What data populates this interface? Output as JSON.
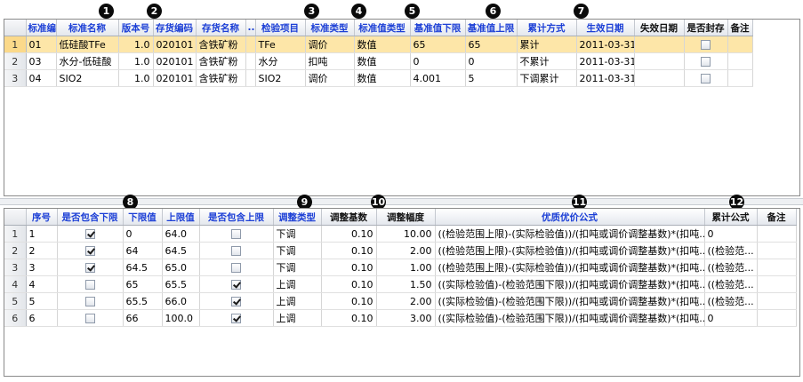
{
  "top_table": {
    "columns": [
      "",
      "标准编码",
      "标准名称",
      "版本号",
      "存货编码",
      "存货名称",
      "...",
      "检验项目",
      "标准类型",
      "标准值类型",
      "基准值下限",
      "基准值上限",
      "累计方式",
      "生效日期",
      "失效日期",
      "是否封存",
      "备注"
    ],
    "rows": [
      {
        "n": "1",
        "code": "01",
        "name": "低硅酸TFe",
        "version": "1.0",
        "inv_code": "020101",
        "inv_name": "含铁矿粉",
        "more": "",
        "item": "TFe",
        "std_type": "调价",
        "value_type": "数值",
        "lower": "65",
        "upper": "65",
        "accum": "累计",
        "effective": "2011-03-31",
        "expire": "",
        "sealed": false,
        "note": ""
      },
      {
        "n": "2",
        "code": "03",
        "name": "水分-低硅酸",
        "version": "1.0",
        "inv_code": "020101",
        "inv_name": "含铁矿粉",
        "more": "",
        "item": "水分",
        "std_type": "扣吨",
        "value_type": "数值",
        "lower": "0",
        "upper": "0",
        "accum": "不累计",
        "effective": "2011-03-31",
        "expire": "",
        "sealed": false,
        "note": ""
      },
      {
        "n": "3",
        "code": "04",
        "name": "SIO2",
        "version": "1.0",
        "inv_code": "020101",
        "inv_name": "含铁矿粉",
        "more": "",
        "item": "SIO2",
        "std_type": "调价",
        "value_type": "数值",
        "lower": "4.001",
        "upper": "5",
        "accum": "下调累计",
        "effective": "2011-03-31",
        "expire": "",
        "sealed": false,
        "note": ""
      }
    ]
  },
  "bottom_table": {
    "columns": [
      "",
      "序号",
      "是否包含下限",
      "下限值",
      "上限值",
      "是否包含上限",
      "调整类型",
      "调整基数",
      "调整幅度",
      "优质优价公式",
      "累计公式",
      "备注"
    ],
    "rows": [
      {
        "n": "1",
        "seq": "1",
        "incl_lower": true,
        "lower": "0",
        "upper": "64.0",
        "incl_upper": false,
        "adj_type": "下调",
        "base": "0.10",
        "range": "10.00",
        "formula": "((检验范围上限)-(实际检验值))/(扣吨或调价调整基数)*(扣吨...",
        "accum": "0",
        "note": ""
      },
      {
        "n": "2",
        "seq": "2",
        "incl_lower": true,
        "lower": "64",
        "upper": "64.5",
        "incl_upper": false,
        "adj_type": "下调",
        "base": "0.10",
        "range": "2.00",
        "formula": "((检验范围上限)-(实际检验值))/(扣吨或调价调整基数)*(扣吨...",
        "accum": "((检验范...",
        "note": ""
      },
      {
        "n": "3",
        "seq": "3",
        "incl_lower": true,
        "lower": "64.5",
        "upper": "65.0",
        "incl_upper": false,
        "adj_type": "下调",
        "base": "0.10",
        "range": "1.00",
        "formula": "((检验范围上限)-(实际检验值))/(扣吨或调价调整基数)*(扣吨...",
        "accum": "((检验范...",
        "note": ""
      },
      {
        "n": "4",
        "seq": "4",
        "incl_lower": false,
        "lower": "65",
        "upper": "65.5",
        "incl_upper": true,
        "adj_type": "上调",
        "base": "0.10",
        "range": "1.50",
        "formula": "((实际检验值)-(检验范围下限))/(扣吨或调价调整基数)*(扣吨...",
        "accum": "((检验范...",
        "note": ""
      },
      {
        "n": "5",
        "seq": "5",
        "incl_lower": false,
        "lower": "65.5",
        "upper": "66.0",
        "incl_upper": true,
        "adj_type": "上调",
        "base": "0.10",
        "range": "2.00",
        "formula": "((实际检验值)-(检验范围下限))/(扣吨或调价调整基数)*(扣吨...",
        "accum": "((检验范...",
        "note": ""
      },
      {
        "n": "6",
        "seq": "6",
        "incl_lower": false,
        "lower": "66",
        "upper": "100.0",
        "incl_upper": true,
        "adj_type": "上调",
        "base": "0.10",
        "range": "3.00",
        "formula": "((实际检验值)-(检验范围下限))/(扣吨或调价调整基数)*(扣吨...",
        "accum": "0",
        "note": ""
      }
    ]
  },
  "badges": [
    "1",
    "2",
    "3",
    "4",
    "5",
    "6",
    "7",
    "8",
    "9",
    "10",
    "11",
    "12"
  ],
  "colors": {
    "header_text": "#1c3fd6",
    "selected_row": "#fde6a8",
    "badge": "#0a0a0a"
  }
}
